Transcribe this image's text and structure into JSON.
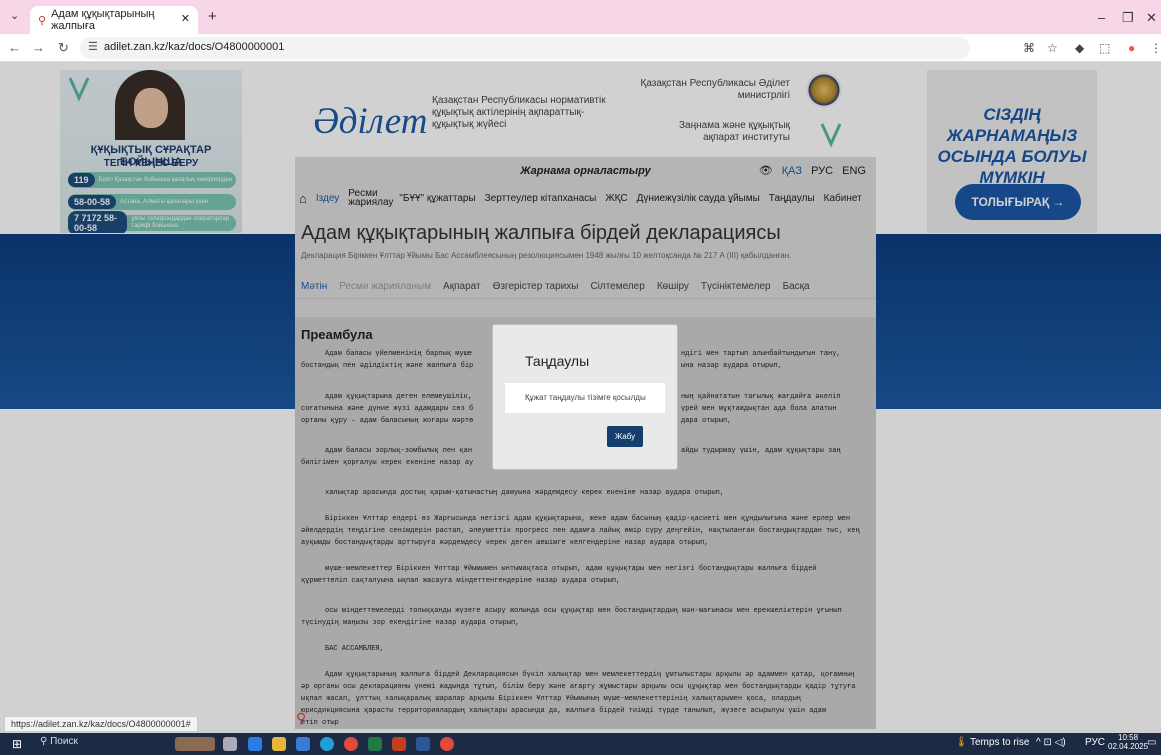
{
  "browser": {
    "tab_title": "Адам құқықтарының жалпыға",
    "url": "adilet.zan.kz/kaz/docs/O4800000001",
    "status_url": "https://adilet.zan.kz/kaz/docs/O4800000001#"
  },
  "left_ad": {
    "heading": "ҚҰҚЫҚТЫҚ СҰРАҚТАР БОЙЫНША",
    "subheading": "ТЕГІН КЕҢЕС БЕРУ",
    "pills": [
      {
        "number": "119",
        "text": "Бүкіл Қазақстан бойынша қалалық нөмірлерден"
      },
      {
        "number": "58-00-58",
        "text": "Астана, Алматы қалалары үшін"
      },
      {
        "number": "7 7172 58-00-58",
        "text": "ұялы телефондардан операторлар тарифі бойынша"
      }
    ]
  },
  "header": {
    "logo": "Әділет",
    "logo_text": "Қазақстан Республикасы нормативтік құқықтық актілерінің ақпараттық-құқықтық жүйесі",
    "ministry": "Қазақстан Республикасы Әділет министрлігі",
    "institute": "Заңнама және құқықтық ақпарат институты"
  },
  "right_ad": {
    "text": "СІЗДІҢ ЖАРНАМАҢЫЗ ОСЫНДА БОЛУЫ МҮМКІН",
    "button": "ТОЛЫҒЫРАҚ"
  },
  "topbar": {
    "ad_label": "Жарнама орналастыру",
    "langs": [
      "ҚАЗ",
      "РУС",
      "ENG"
    ]
  },
  "menu": [
    "Іздеу",
    "Ресми жариялау",
    "\"БҰҰ\" құжаттары",
    "Зерттеулер кітапханасы",
    "ЖҚС",
    "Дүниежүзілік сауда ұйымы",
    "Таңдаулы",
    "Кабинет"
  ],
  "document": {
    "title": "Адам құқықтарының жалпыға бірдей декларациясы",
    "subtitle": "Декларация Біріккен Ұлттар Ұйымы Бас Ассамблеясының резолюциясымен 1948 жылғы 10 желтоқсанда № 217 A (III) қабылданған.",
    "tabs": [
      "Мәтін",
      "Ресми жарияланым",
      "Ақпарат",
      "Өзгерістер тарихы",
      "Сілтемелер",
      "Көшіру",
      "Түсініктемелер",
      "Басқа"
    ],
    "section": "Преамбула",
    "paragraphs": [
      "Адам баласы үйелменінің барлық муше",
      "ндігі мен тартып алынбайтындығын тану,",
      "бостандық пен әділдіктің және жалпыға бір",
      "ына назар аудара отырып,",
      "адам құқықтарына деген елемеушілік,",
      "ның қайнататын тағылық жағдайға әкеліп",
      "соғатынына және дүние жүзі адамдары сөз б",
      "үрей мен мұқтаждықтан ада бола алатын",
      "ортаны құру – адам баласының жоғары мәртө",
      "дара отырып,",
      "адам баласы зорлық-зомбылық пен қан",
      "айды тудырмау үшін, адам құқықтары заң",
      "билігімен қорғалуы керек екеніне назар ау",
      "халықтар арасында достық қарым-қатынастың дамуына жәрдемдесу керек екеніне назар аудара отырып,",
      "Біріккен Ұлттар елдері өз Жарғысында негізгі адам құқықтарына, жеке адам басының қадір-қасиеті мен құндылығына және ерлер мен әйелдердің теңдігіне сенімдерін растап, әлеуметтік прогресс пен адамға лайық өмір сүру деңгейін, нақтыланған бостандықтардан тыс, кең ауқымды бостандықтарды арттыруға жәрдемдесу керек деген шешімге келгендеріне назар аудара отырып,",
      "мүше-мемлекеттер Біріккен Ұлттар Ұйымымен ынтымақтаса отырып, адам құқықтары мен негізгі бостандықтары жалпыға бірдей құрметтеліп сақталуына ықпал жасауға міндеттенгендеріне назар аудара отырып,",
      "осы міндеттемелерді толыққанды жүзеге асыру жолында осы құқықтар мен бостандықтардың мән-мағынасы мен ерекшеліктерін ұғынып түсінудің маңызы зор екендігіне назар аудара отырып,",
      "БАС АССАМБЛЕЯ,",
      "Адам құқықтарының жалпыға бірдей Декларациясын бүкіл халықтар мен мемлекеттердің ұмтылыстары арқылы әр адаммен қатар, қоғамның әр органы осы декларацияны үнемі жадында тұтып, білім беру және ағарту жұмыстары арқылы осы құқықтар мен бостандықтарды қадір тұтуға ықпал жасап, ұлттық халықаралық шаралар арқылы Біріккен Ұлттар Ұйымының мүше-мемлекеттерінің халықтарымен қоса, олардың юрисдикциясына қарасты территориялардың халықтары арасында да, жалпыға бірдей тиімді түрде танылып, жүзеге асырылуы үшін адам",
      "етіп отыр"
    ]
  },
  "modal": {
    "title": "Таңдаулы",
    "message": "Құжат таңдаулы тізімге қосылды",
    "close": "Жабу"
  },
  "taskbar": {
    "search": "Поиск",
    "weather": "Temps to rise",
    "lang": "РУС",
    "time": "10:58",
    "date": "02.04.2025"
  },
  "colors": {
    "brand": "#1d5aa8",
    "band": "#0e3e80",
    "modal_button": "#153e6e",
    "tab_strip": "#f7d6e8"
  }
}
